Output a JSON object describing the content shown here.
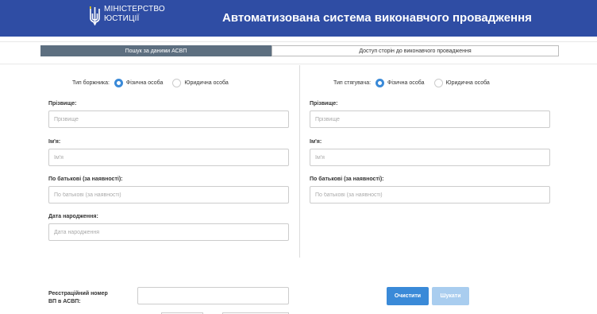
{
  "header": {
    "logo_text": "МІНІСТЕРСТВО\nЮСТИЦІЇ",
    "title": "Автоматизована система виконавчого провадження",
    "icons": [
      "trident-icon"
    ],
    "colors": {
      "header_bg": "#2f4da4",
      "accent": "#3a8ad8",
      "tab_active_bg": "#5d6f80"
    }
  },
  "tabs": [
    {
      "label": "Пошук за даними АСВП",
      "active": true
    },
    {
      "label": "Доступ сторін до виконавчого провадження",
      "active": false
    }
  ],
  "debtor": {
    "type_label": "Тип боржника:",
    "options": [
      "Фізична особа",
      "Юридична особа"
    ],
    "selected": "Фізична особа",
    "fields": [
      {
        "label": "Прізвище:",
        "placeholder": "Прізвище"
      },
      {
        "label": "Ім'я:",
        "placeholder": "Ім'я"
      },
      {
        "label": "По батькові (за наявності):",
        "placeholder": "По батькові (за наявності)"
      },
      {
        "label": "Дата народження:",
        "placeholder": "Дата народження"
      }
    ]
  },
  "creditor": {
    "type_label": "Тип стягувача:",
    "options": [
      "Фізична особа",
      "Юридична особа"
    ],
    "selected": "Фізична особа",
    "fields": [
      {
        "label": "Прізвище:",
        "placeholder": "Прізвище"
      },
      {
        "label": "Ім'я:",
        "placeholder": "Ім'я"
      },
      {
        "label": "По батькові (за наявності):",
        "placeholder": "По батькові (за наявності)"
      }
    ]
  },
  "registration": {
    "label": "Реєстраційний номер ВП в АСВП:",
    "value": ""
  },
  "buttons": {
    "clear": "Очистити",
    "search": "Шукати"
  }
}
